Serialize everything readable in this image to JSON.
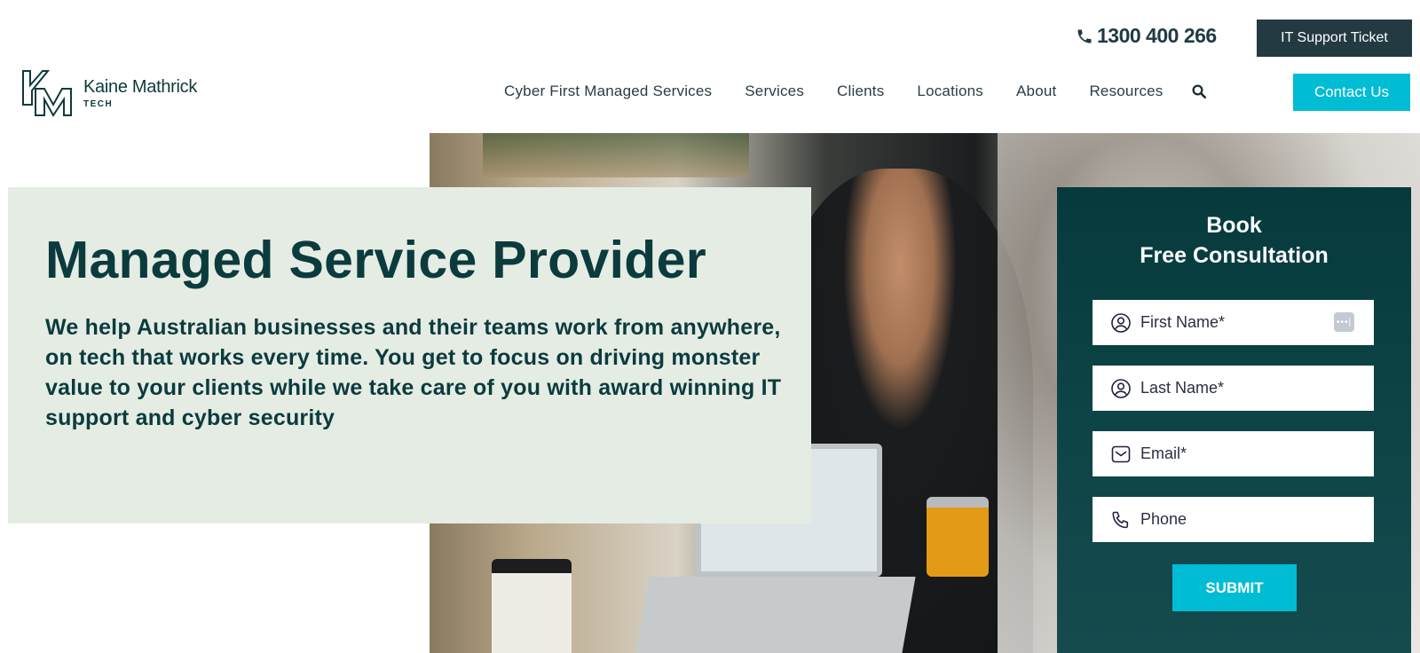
{
  "header": {
    "phone_number": "1300 400 266",
    "ticket_button": "IT Support Ticket",
    "logo": {
      "name": "Kaine Mathrick",
      "subtitle": "TECH"
    },
    "nav": [
      {
        "label": "Cyber First Managed Services"
      },
      {
        "label": "Services"
      },
      {
        "label": "Clients"
      },
      {
        "label": "Locations"
      },
      {
        "label": "About"
      },
      {
        "label": "Resources"
      }
    ],
    "search_icon": "search-icon",
    "contact_button": "Contact Us"
  },
  "hero": {
    "title": "Managed Service Provider",
    "description": "We help Australian businesses and their teams work from anywhere, on tech that works every time.  You get to focus on driving monster value to your clients while we take care of you with award winning IT support and cyber security"
  },
  "form": {
    "title_line1": "Book",
    "title_line2": "Free Consultation",
    "fields": [
      {
        "placeholder": "First Name*",
        "icon": "user-icon"
      },
      {
        "placeholder": "Last Name*",
        "icon": "user-icon"
      },
      {
        "placeholder": "Email*",
        "icon": "mail-icon"
      },
      {
        "placeholder": "Phone",
        "icon": "phone-icon"
      }
    ],
    "submit_label": "SUBMIT"
  },
  "colors": {
    "primary_dark": "#0b3b3d",
    "accent": "#00bcd4",
    "ticket_button": "#233a43",
    "intro_background": "#e5ece4"
  }
}
